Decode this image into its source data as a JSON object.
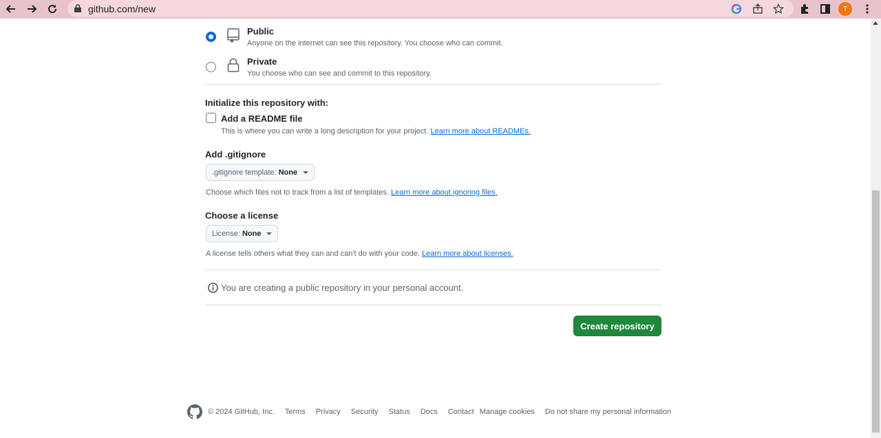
{
  "browser": {
    "url": "github.com/new",
    "profile_initial": "T",
    "accent_color": "#e9c3cc"
  },
  "visibility": {
    "public": {
      "title": "Public",
      "description": "Anyone on the internet can see this repository. You choose who can commit.",
      "selected": true
    },
    "private": {
      "title": "Private",
      "description": "You choose who can see and commit to this repository.",
      "selected": false
    }
  },
  "initialize": {
    "heading": "Initialize this repository with:",
    "readme_label": "Add a README file",
    "readme_checked": false,
    "readme_note": "This is where you can write a long description for your project.",
    "readme_link": "Learn more about READMEs."
  },
  "gitignore": {
    "heading": "Add .gitignore",
    "select_prefix": ".gitignore template:",
    "select_value": "None",
    "note": "Choose which files not to track from a list of templates.",
    "link": "Learn more about ignoring files."
  },
  "license": {
    "heading": "Choose a license",
    "select_prefix": "License:",
    "select_value": "None",
    "note": "A license tells others what they can and can't do with your code.",
    "link": "Learn more about licenses."
  },
  "info": {
    "message": "You are creating a public repository in your personal account."
  },
  "actions": {
    "create_label": "Create repository",
    "create_color": "#1f883d"
  },
  "footer": {
    "copyright": "© 2024 GitHub, Inc.",
    "links": [
      "Terms",
      "Privacy",
      "Security",
      "Status",
      "Docs",
      "Contact",
      "Manage cookies",
      "Do not share my personal information"
    ]
  }
}
